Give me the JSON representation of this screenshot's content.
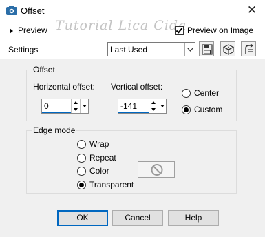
{
  "window": {
    "title": "Offset",
    "close_glyph": "✕"
  },
  "header": {
    "preview_toggle_label": "Preview",
    "watermark": "Tutorial Lica Cida",
    "preview_on_image_label": "Preview on Image",
    "preview_on_image_checked": true,
    "settings_label": "Settings",
    "preset_value": "Last Used",
    "icon_buttons": [
      "save-preset-icon",
      "randomize-dice-icon",
      "reset-icon"
    ]
  },
  "offset_group": {
    "label": "Offset",
    "horizontal_label": "Horizontal offset:",
    "horizontal_value": "0",
    "vertical_label": "Vertical offset:",
    "vertical_value": "-141",
    "origin_options": [
      "Center",
      "Custom"
    ],
    "origin_selected": "Custom"
  },
  "edge_group": {
    "label": "Edge mode",
    "options": [
      "Wrap",
      "Repeat",
      "Color",
      "Transparent"
    ],
    "selected": "Transparent",
    "color_swatch_icon": "disabled-circle-icon"
  },
  "buttons": {
    "ok": "OK",
    "cancel": "Cancel",
    "help": "Help"
  },
  "colors": {
    "accent": "#0067c0",
    "dialog_bg": "#f0f0f0",
    "app_icon": "#2b6ea8"
  }
}
